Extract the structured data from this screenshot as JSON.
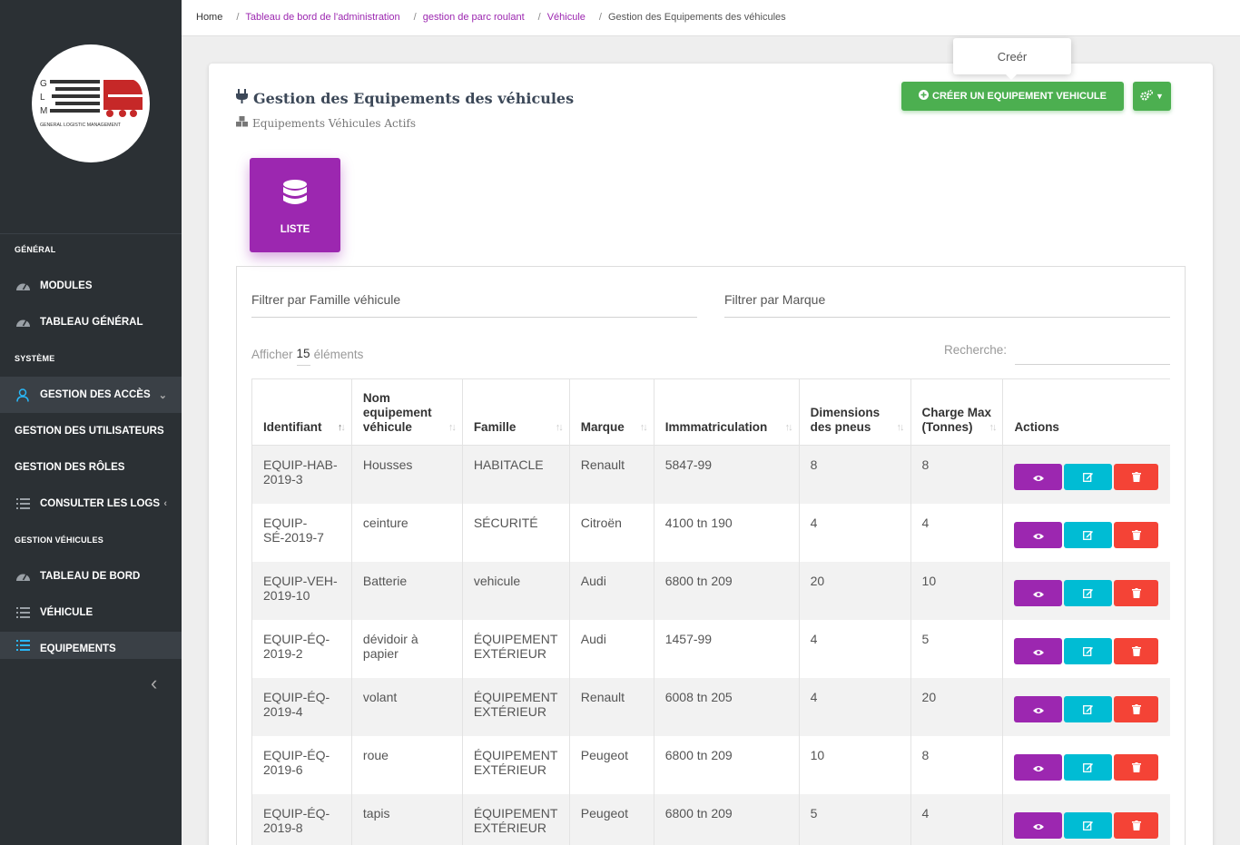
{
  "logo": {
    "letters": [
      "G",
      "L",
      "M"
    ],
    "tagline": "GENERAL LOGISTIC MANAGEMENT"
  },
  "sidebar": {
    "sections": {
      "general": "GÉNÉRAL",
      "systeme": "SYSTÈME",
      "gestion_vehicules": "GESTION VÉHICULES"
    },
    "items": {
      "modules": "MODULES",
      "tableau_general": "TABLEAU GÉNÉRAL",
      "gestion_acces": "GESTION DES ACCÈS",
      "gestion_utilisateurs": "GESTION DES UTILISATEURS",
      "gestion_roles": "GESTION DES RÔLES",
      "consulter_logs": "CONSULTER LES LOGS",
      "tableau_de_bord": "TABLEAU DE BORD",
      "vehicule": "VÉHICULE",
      "equipements": "EQUIPEMENTS"
    }
  },
  "breadcrumb": {
    "home": "Home",
    "admin": "Tableau de bord de l'administration",
    "parc": "gestion de parc roulant",
    "vehicule": "Véhicule",
    "current": "Gestion des Equipements des véhicules",
    "sep": "/"
  },
  "page": {
    "title": "Gestion des Equipements des véhicules",
    "subtitle": "Equipements Véhicules Actifs",
    "create_button": "CRÉER UN EQUIPEMENT VEHICULE",
    "tooltip": "Creér",
    "tab_liste": "LISTE"
  },
  "filters": {
    "famille": "Filtrer par Famille véhicule",
    "marque": "Filtrer par Marque"
  },
  "table_controls": {
    "show_prefix": "Afficher",
    "show_count": "15",
    "show_suffix": "éléments",
    "search_label": "Recherche:"
  },
  "table": {
    "headers": [
      "Identifiant",
      "Nom equipement véhicule",
      "Famille",
      "Marque",
      "Immmatriculation",
      "Dimensions des pneus",
      "Charge Max (Tonnes)",
      "Actions"
    ],
    "rows": [
      [
        "EQUIP-HAB-2019-3",
        "Housses",
        "HABITACLE",
        "Renault",
        "5847-99",
        "8",
        "8"
      ],
      [
        "EQUIP-SÉ-2019-7",
        "ceinture",
        "SÉCURITÉ",
        "Citroën",
        "4100 tn 190",
        "4",
        "4"
      ],
      [
        "EQUIP-VEH-2019-10",
        "Batterie",
        "vehicule",
        "Audi",
        "6800 tn 209",
        "20",
        "10"
      ],
      [
        "EQUIP-ÉQ-2019-2",
        "dévidoir à papier",
        "ÉQUIPEMENT EXTÉRIEUR",
        "Audi",
        "1457-99",
        "4",
        "5"
      ],
      [
        "EQUIP-ÉQ-2019-4",
        "volant",
        "ÉQUIPEMENT EXTÉRIEUR",
        "Renault",
        "6008 tn 205",
        "4",
        "20"
      ],
      [
        "EQUIP-ÉQ-2019-6",
        "roue",
        "ÉQUIPEMENT EXTÉRIEUR",
        "Peugeot",
        "6800 tn 209",
        "10",
        "8"
      ],
      [
        "EQUIP-ÉQ-2019-8",
        "tapis",
        "ÉQUIPEMENT EXTÉRIEUR",
        "Peugeot",
        "6800 tn 209",
        "5",
        "4"
      ]
    ]
  },
  "colors": {
    "sidebar": "#2b3034",
    "primary": "#9c27b0",
    "success": "#4caf50",
    "info": "#00bcd4",
    "danger": "#f44336"
  },
  "icons": {
    "view": "eye-icon",
    "edit": "edit-icon",
    "delete": "trash-icon"
  }
}
